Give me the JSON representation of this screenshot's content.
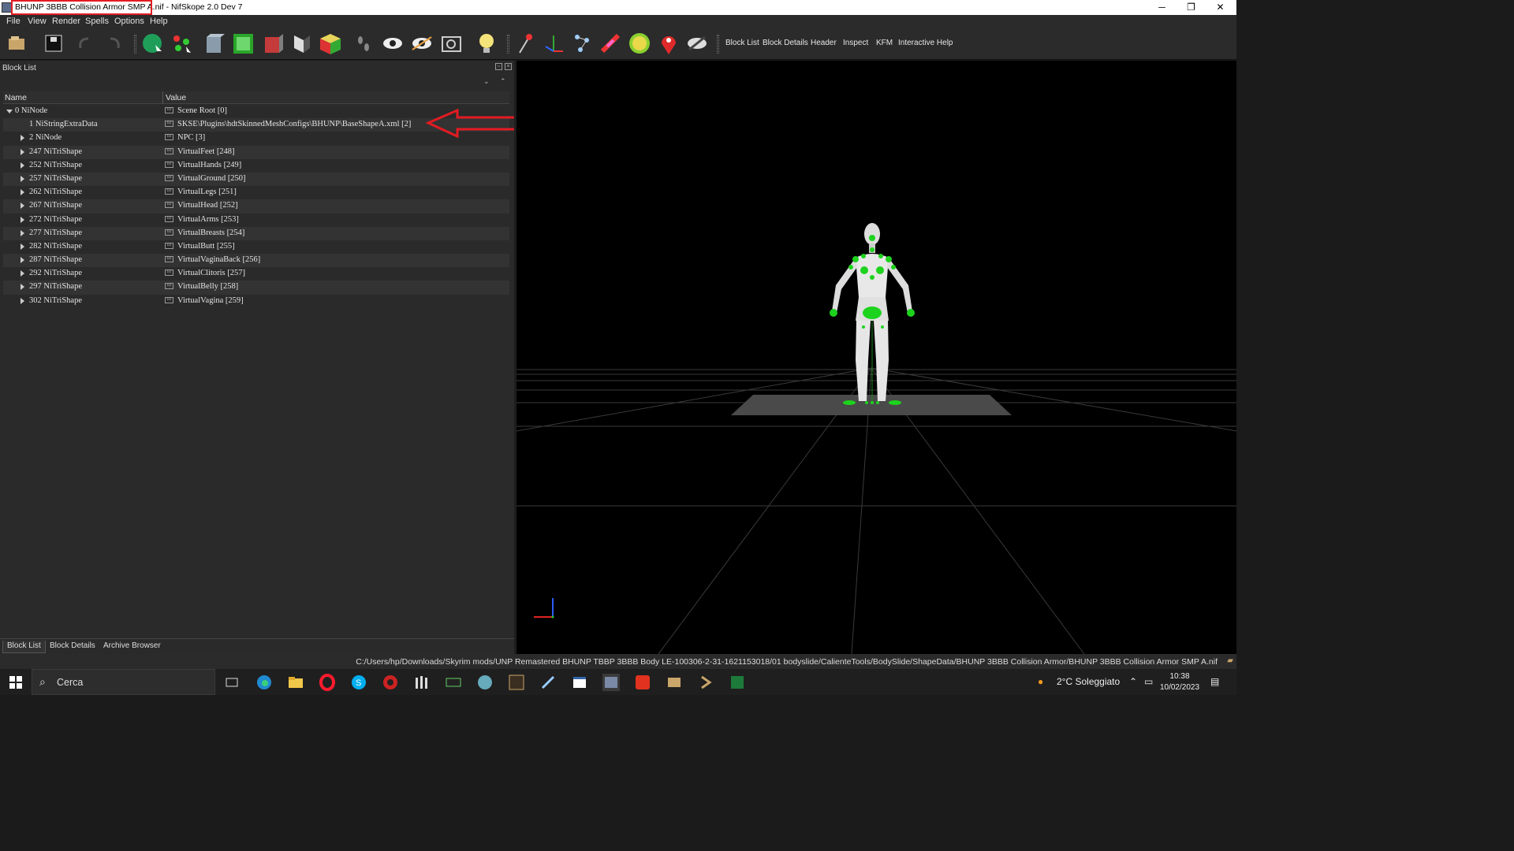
{
  "window": {
    "title": "BHUNP 3BBB Collision Armor SMP A.nif - NifSkope 2.0 Dev 7",
    "title_highlight_color": "#e31b23",
    "controls": {
      "minimize": "─",
      "restore": "❐",
      "close": "✕"
    }
  },
  "menu": [
    "File",
    "View",
    "Render",
    "Spells",
    "Options",
    "Help"
  ],
  "toolbar": {
    "icons": [
      "open-icon",
      "save-icon",
      "undo-icon",
      "redo-icon",
      "select-sphere-icon",
      "select-tree-icon",
      "box-grey-icon",
      "box-green-icon",
      "box-red-icon",
      "half-shade-icon",
      "color-cube-icon",
      "footprints-icon",
      "eye-icon",
      "eye-half-icon",
      "camera-icon",
      "lightbulb-icon",
      "pin-red-icon",
      "axes-icon",
      "skeleton-icon",
      "wand-icon",
      "clock-green-icon",
      "marker-red-icon",
      "eye-strike-icon"
    ],
    "tabs": [
      "Block List",
      "Block Details",
      "Header",
      "Inspect",
      "KFM",
      "Interactive Help"
    ]
  },
  "block_list": {
    "panel_title": "Block List",
    "columns": {
      "name": "Name",
      "value": "Value"
    },
    "rows": [
      {
        "name": "0 NiNode",
        "value": "Scene Root [0]",
        "level": 0,
        "expander": "down"
      },
      {
        "name": "1 NiStringExtraData",
        "value": "SKSE\\Plugins\\hdtSkinnedMeshConfigs\\BHUNP\\BaseShapeA.xml [2]",
        "level": 1,
        "expander": "none"
      },
      {
        "name": "2 NiNode",
        "value": "NPC [3]",
        "level": 1,
        "expander": "right"
      },
      {
        "name": "247 NiTriShape",
        "value": "VirtualFeet [248]",
        "level": 1,
        "expander": "right"
      },
      {
        "name": "252 NiTriShape",
        "value": "VirtualHands [249]",
        "level": 1,
        "expander": "right"
      },
      {
        "name": "257 NiTriShape",
        "value": "VirtualGround [250]",
        "level": 1,
        "expander": "right"
      },
      {
        "name": "262 NiTriShape",
        "value": "VirtualLegs [251]",
        "level": 1,
        "expander": "right"
      },
      {
        "name": "267 NiTriShape",
        "value": "VirtualHead [252]",
        "level": 1,
        "expander": "right"
      },
      {
        "name": "272 NiTriShape",
        "value": "VirtualArms [253]",
        "level": 1,
        "expander": "right"
      },
      {
        "name": "277 NiTriShape",
        "value": "VirtualBreasts [254]",
        "level": 1,
        "expander": "right"
      },
      {
        "name": "282 NiTriShape",
        "value": "VirtualButt [255]",
        "level": 1,
        "expander": "right"
      },
      {
        "name": "287 NiTriShape",
        "value": "VirtualVaginaBack [256]",
        "level": 1,
        "expander": "right"
      },
      {
        "name": "292 NiTriShape",
        "value": "VirtualClitoris [257]",
        "level": 1,
        "expander": "right"
      },
      {
        "name": "297 NiTriShape",
        "value": "VirtualBelly [258]",
        "level": 1,
        "expander": "right"
      },
      {
        "name": "302 NiTriShape",
        "value": "VirtualVagina [259]",
        "level": 1,
        "expander": "right"
      }
    ],
    "annotation_arrow_color": "#e31b23"
  },
  "bottom_tabs": [
    "Block List",
    "Block Details",
    "Archive Browser"
  ],
  "status_path": "C:/Users/hp/Downloads/Skyrim mods/UNP Remastered BHUNP TBBP 3BBB Body LE-100306-2-31-1621153018/01 bodyslide/CalienteTools/BodySlide/ShapeData/BHUNP 3BBB Collision Armor/BHUNP 3BBB Collision Armor SMP A.nif",
  "taskbar": {
    "search_placeholder": "Cerca",
    "weather": "2°C  Soleggiato",
    "time": "10:38",
    "date": "10/02/2023"
  }
}
